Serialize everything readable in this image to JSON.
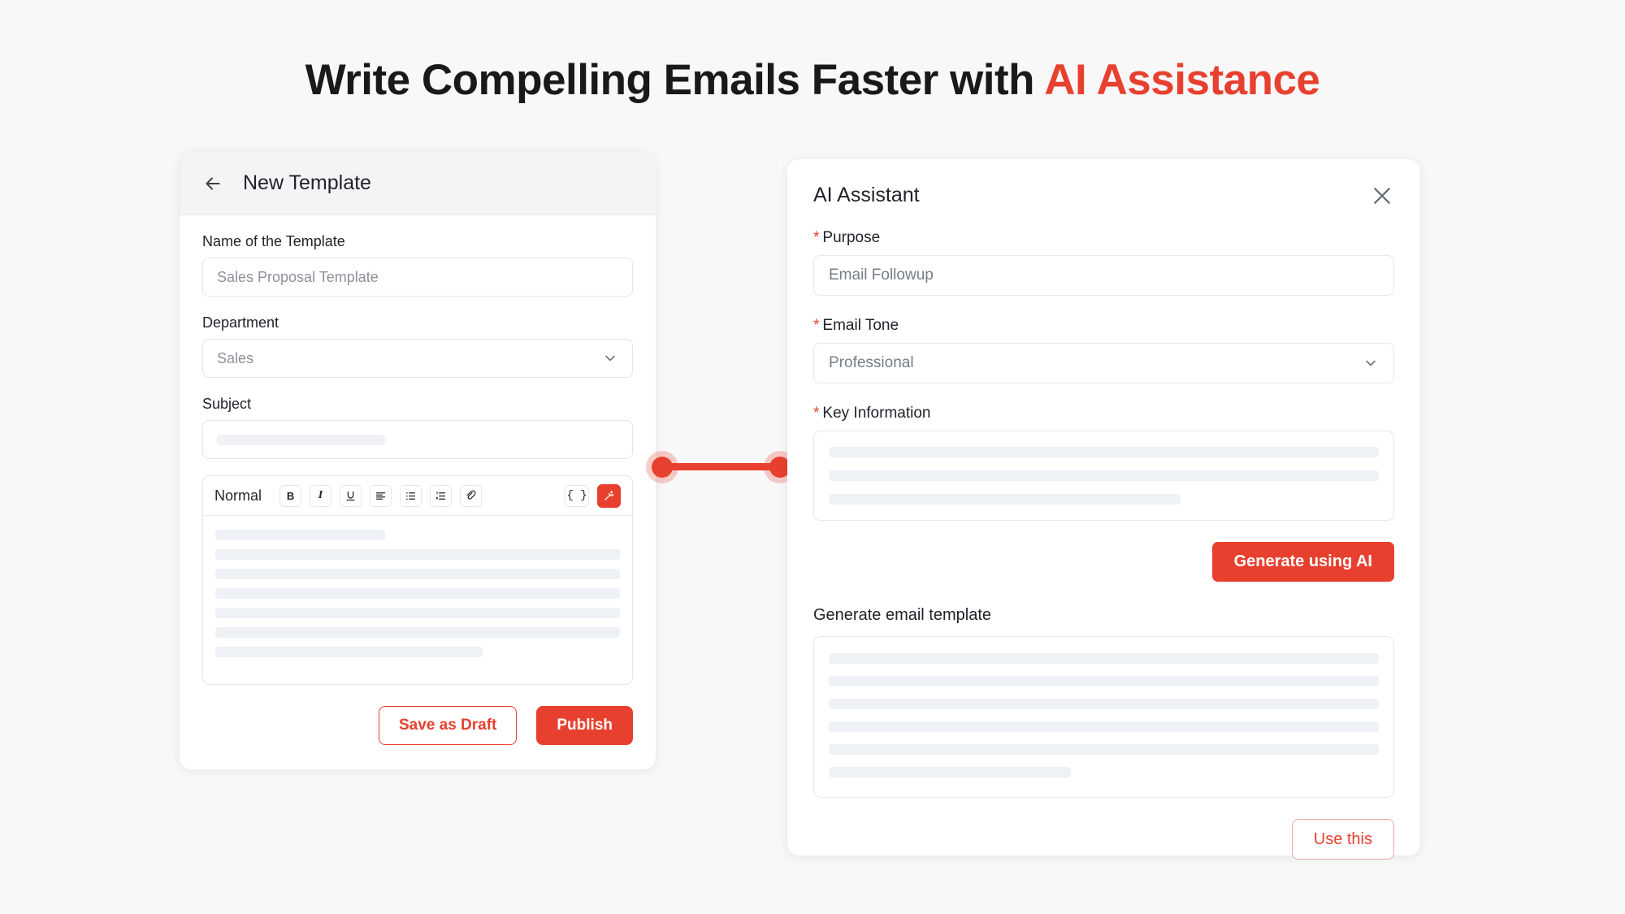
{
  "headline": {
    "text_main": "Write Compelling Emails Faster with ",
    "text_accent": "AI Assistance"
  },
  "colors": {
    "accent": "#e8402f",
    "page_background": "#f8f8f9",
    "card_background": "#ffffff",
    "skeleton": "#eef1f5",
    "header_background": "#f4f4f6"
  },
  "left_panel": {
    "header": {
      "back_icon": "arrow-left-icon",
      "title": "New Template"
    },
    "fields": {
      "name_label": "Name of the Template",
      "name_placeholder": "Sales Proposal Template",
      "name_value": "",
      "department_label": "Department",
      "department_value": "Sales",
      "department_options": [
        "Sales"
      ],
      "subject_label": "Subject"
    },
    "editor": {
      "style_selector": "Normal",
      "tools": [
        {
          "name": "bold-icon",
          "label": "B"
        },
        {
          "name": "italic-icon",
          "label": "I"
        },
        {
          "name": "underline-icon",
          "label": "U"
        },
        {
          "name": "align-left-icon",
          "label": ""
        },
        {
          "name": "bullet-list-icon",
          "label": ""
        },
        {
          "name": "numbered-list-icon",
          "label": ""
        },
        {
          "name": "link-icon",
          "label": ""
        }
      ],
      "variable_button": "{ }",
      "ai_button_icon": "magic-wand-icon",
      "body_skeleton_widths": [
        "42%",
        "100%",
        "100%",
        "100%",
        "100%",
        "100%",
        "66%"
      ],
      "subject_skeleton_width": "42%"
    },
    "actions": {
      "save_draft_label": "Save as Draft",
      "publish_label": "Publish"
    }
  },
  "right_panel": {
    "title": "AI Assistant",
    "close_icon": "close-icon",
    "purpose": {
      "label": "Purpose",
      "required_marker": "*",
      "value": "Email Followup"
    },
    "email_tone": {
      "label": "Email Tone",
      "required_marker": "*",
      "value": "Professional",
      "options": [
        "Professional"
      ]
    },
    "key_information": {
      "label": "Key Information",
      "required_marker": "*",
      "skeleton_widths": [
        "100%",
        "100%",
        "64%"
      ]
    },
    "generate_button": "Generate using AI",
    "output": {
      "label": "Generate email template",
      "skeleton_widths": [
        "100%",
        "100%",
        "100%",
        "100%",
        "100%",
        "44%"
      ]
    },
    "use_button": "Use this"
  },
  "connector": {
    "name": "panel-connector",
    "left_dot": "connector-dot-left",
    "right_dot": "connector-dot-right"
  }
}
